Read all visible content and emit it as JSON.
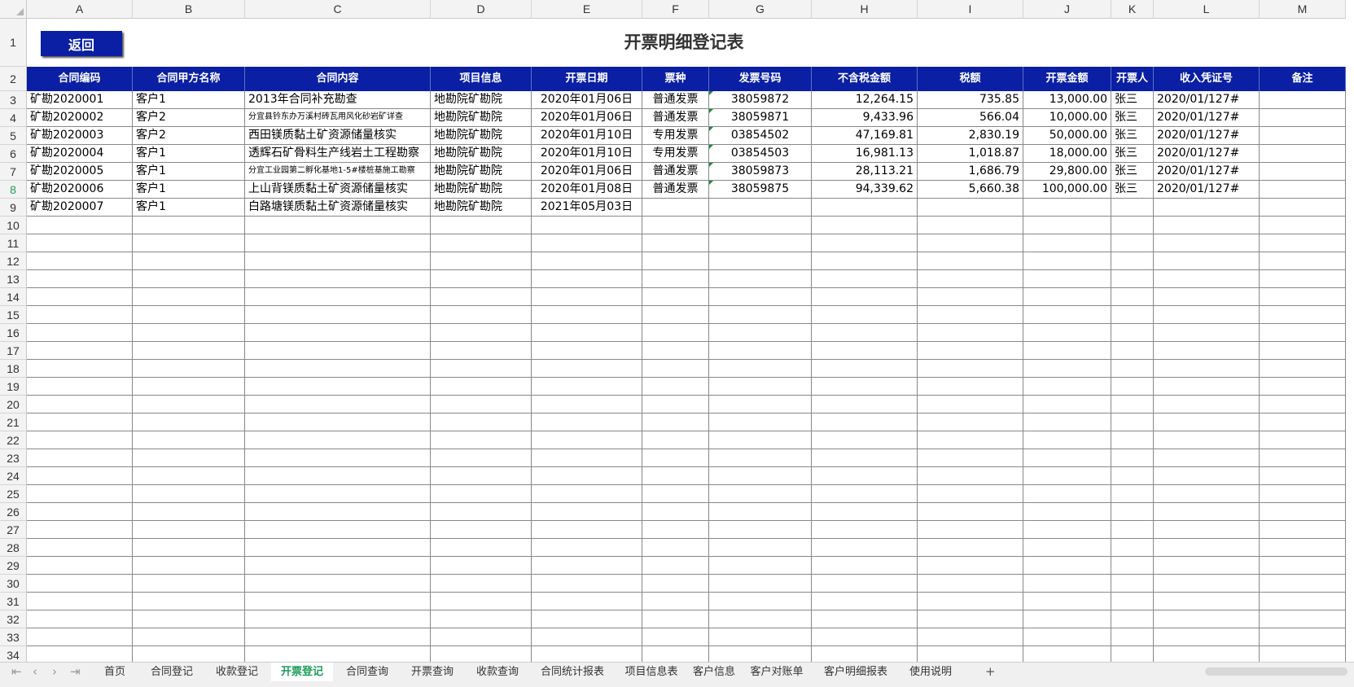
{
  "title": "开票明细登记表",
  "back_button": "返回",
  "columns": [
    "A",
    "B",
    "C",
    "D",
    "E",
    "F",
    "G",
    "H",
    "I",
    "J",
    "K",
    "L",
    "M"
  ],
  "headers": [
    "合同编码",
    "合同甲方名称",
    "合同内容",
    "项目信息",
    "开票日期",
    "票种",
    "发票号码",
    "不含税金额",
    "税额",
    "开票金额",
    "开票人",
    "收入凭证号",
    "备注"
  ],
  "rows": [
    [
      "矿勘2020001",
      "客户1",
      "2013年合同补充勘查",
      "地勘院矿勘院",
      "2020年01月06日",
      "普通发票",
      "38059872",
      "12,264.15",
      "735.85",
      "13,000.00",
      "张三",
      "2020/01/127#",
      ""
    ],
    [
      "矿勘2020002",
      "客户2",
      "分宜县钤东办万溪村砖瓦用风化砂岩矿详查",
      "地勘院矿勘院",
      "2020年01月06日",
      "普通发票",
      "38059871",
      "9,433.96",
      "566.04",
      "10,000.00",
      "张三",
      "2020/01/127#",
      ""
    ],
    [
      "矿勘2020003",
      "客户2",
      "西田镁质黏土矿资源储量核实",
      "地勘院矿勘院",
      "2020年01月10日",
      "专用发票",
      "03854502",
      "47,169.81",
      "2,830.19",
      "50,000.00",
      "张三",
      "2020/01/127#",
      ""
    ],
    [
      "矿勘2020004",
      "客户1",
      "透辉石矿骨料生产线岩土工程勘察",
      "地勘院矿勘院",
      "2020年01月10日",
      "专用发票",
      "03854503",
      "16,981.13",
      "1,018.87",
      "18,000.00",
      "张三",
      "2020/01/127#",
      ""
    ],
    [
      "矿勘2020005",
      "客户1",
      "分宜工业园第二孵化基地1-5#楼桩基施工勘察",
      "地勘院矿勘院",
      "2020年01月06日",
      "普通发票",
      "38059873",
      "28,113.21",
      "1,686.79",
      "29,800.00",
      "张三",
      "2020/01/127#",
      ""
    ],
    [
      "矿勘2020006",
      "客户1",
      "上山背镁质黏土矿资源储量核实",
      "地勘院矿勘院",
      "2020年01月08日",
      "普通发票",
      "38059875",
      "94,339.62",
      "5,660.38",
      "100,000.00",
      "张三",
      "2020/01/127#",
      ""
    ],
    [
      "矿勘2020007",
      "客户1",
      "白路塘镁质黏土矿资源储量核实",
      "地勘院矿勘院",
      "2021年05月03日",
      "",
      "",
      "",
      "",
      "",
      "",
      "",
      ""
    ]
  ],
  "row_numbers": [
    "1",
    "2",
    "3",
    "4",
    "5",
    "6",
    "7",
    "8",
    "9",
    "10",
    "11",
    "12",
    "13",
    "14",
    "15",
    "16",
    "17",
    "18",
    "19",
    "20",
    "21",
    "22",
    "23",
    "24",
    "25",
    "26",
    "27",
    "28",
    "29",
    "30",
    "31",
    "32",
    "33",
    "34"
  ],
  "active_row": "8",
  "sheet_tabs": [
    "首页",
    "合同登记",
    "收款登记",
    "开票登记",
    "合同查询",
    "开票查询",
    "收款查询",
    "合同统计报表",
    "项目信息表",
    "客户信息",
    "客户对账单",
    "客户明细报表",
    "使用说明"
  ],
  "active_tab": "开票登记",
  "add_sheet": "+",
  "colors": {
    "header_bg": "#0a1fa3",
    "active_green": "#1e9c5c"
  }
}
